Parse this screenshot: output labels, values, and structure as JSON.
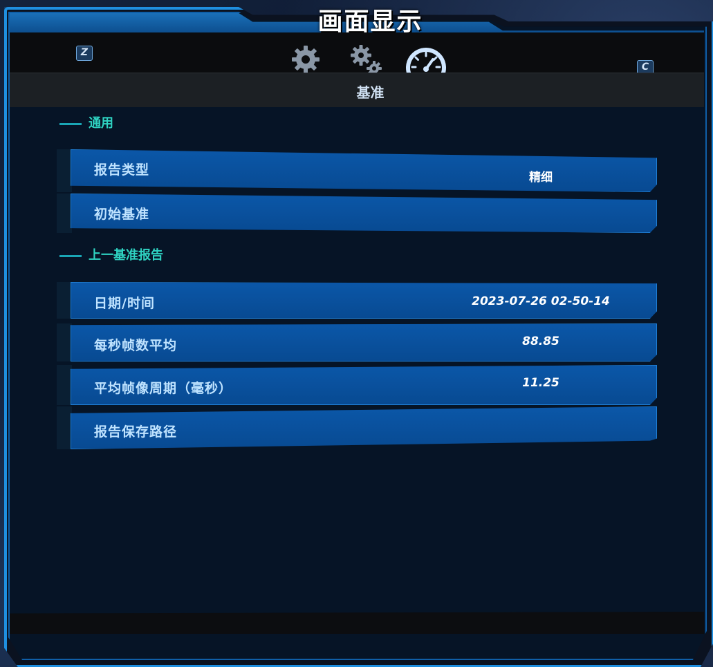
{
  "window": {
    "title": "画面显示"
  },
  "toolbar": {
    "left_key": "Z",
    "right_key": "C",
    "tabs": [
      {
        "icon": "gear-icon"
      },
      {
        "icon": "gears-icon"
      },
      {
        "icon": "speedometer-icon",
        "active": true
      }
    ]
  },
  "section": {
    "title": "基准"
  },
  "groups": {
    "general": {
      "header": "通用",
      "rows": [
        {
          "label": "报告类型",
          "value": "精细"
        },
        {
          "label": "初始基准",
          "value": ""
        }
      ]
    },
    "last_report": {
      "header": "上一基准报告",
      "rows": [
        {
          "label": "日期/时间",
          "value": "2023-07-26 02-50-14"
        },
        {
          "label": "每秒帧数平均",
          "value": "88.85"
        },
        {
          "label": "平均帧像周期（毫秒）",
          "value": "11.25"
        },
        {
          "label": "报告保存路径",
          "value": ""
        }
      ]
    }
  },
  "colors": {
    "accent": "#1f8fe0",
    "row_bg": "#0b57a8",
    "group_header": "#2fd3c2",
    "row_label": "#bfe3ff"
  }
}
